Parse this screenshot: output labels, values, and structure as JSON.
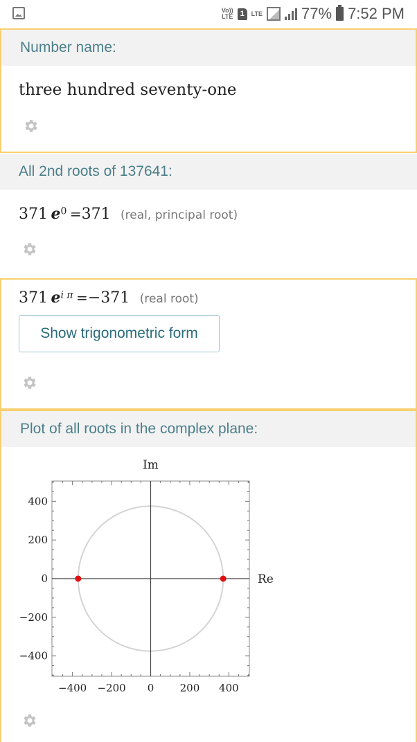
{
  "status_bar": {
    "volte": "Vo)) LTE",
    "sim": "1",
    "lte": "LTE",
    "battery": "77%",
    "time": "7:52 PM"
  },
  "pod_number_name": {
    "title": "Number name:",
    "value": "three hundred seventy-one"
  },
  "pod_roots": {
    "title": "All 2nd roots of 137641:",
    "root1": {
      "base": "371",
      "e": "e",
      "exp": "0",
      "eq": "=",
      "result": "371",
      "note": "(real, principal root)"
    },
    "root2": {
      "base": "371",
      "e": "e",
      "exp": "i π",
      "eq": "=",
      "result": "−371",
      "note": "(real root)"
    },
    "button": "Show trigonometric form"
  },
  "pod_plot": {
    "title": "Plot of all roots in the complex plane:",
    "icons": {
      "settings": "gear-icon"
    }
  },
  "chart_data": {
    "type": "scatter",
    "title": "",
    "xlabel": "Re",
    "ylabel": "Im",
    "xlim": [
      -505,
      505
    ],
    "ylim": [
      -505,
      505
    ],
    "xticks": [
      -400,
      -200,
      0,
      200,
      400
    ],
    "yticks": [
      -400,
      -200,
      0,
      200,
      400
    ],
    "xtick_labels": [
      "−400",
      "−200",
      "0",
      "200",
      "400"
    ],
    "ytick_labels": [
      "400",
      "200",
      "0",
      "−200",
      "−400"
    ],
    "circle_radius": 371,
    "points": [
      {
        "x": 371,
        "y": 0
      },
      {
        "x": -371,
        "y": 0
      }
    ],
    "point_color": "#e01010",
    "circle_color": "#d4d4d4"
  }
}
